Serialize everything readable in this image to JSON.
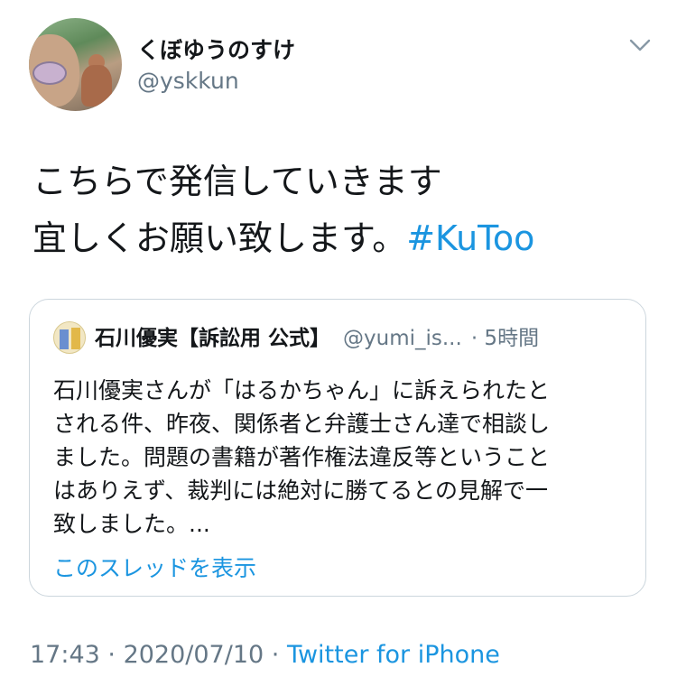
{
  "author": {
    "display_name": "くぼゆうのすけ",
    "handle": "@yskkun"
  },
  "tweet": {
    "lines": [
      "こちらで発信していきます",
      "宜しくお願い致します。"
    ],
    "hashtag": "#KuToo"
  },
  "quoted_tweet": {
    "name": "石川優実【訴訟用 公式】",
    "handle": "@yumi_is...",
    "time": "· 5時間",
    "body_lines": [
      "石川優実さんが「はるかちゃん」に訴えられたと",
      "される件、昨夜、関係者と弁護士さん達で相談し",
      "ました。問題の書籍が著作権法違反等ということ",
      "はありえず、裁判には絶対に勝てるとの見解で一",
      "致しました。..."
    ],
    "show_thread": "このスレッドを表示"
  },
  "meta": {
    "time": "17:43",
    "sep1": " · ",
    "date": "2020/07/10",
    "sep2": " · ",
    "source": "Twitter for iPhone"
  },
  "icons": {
    "menu": "chevron-down-icon"
  },
  "colors": {
    "text": "#14171a",
    "secondary": "#657786",
    "link": "#1b95e0",
    "border": "#ccd6dd"
  }
}
